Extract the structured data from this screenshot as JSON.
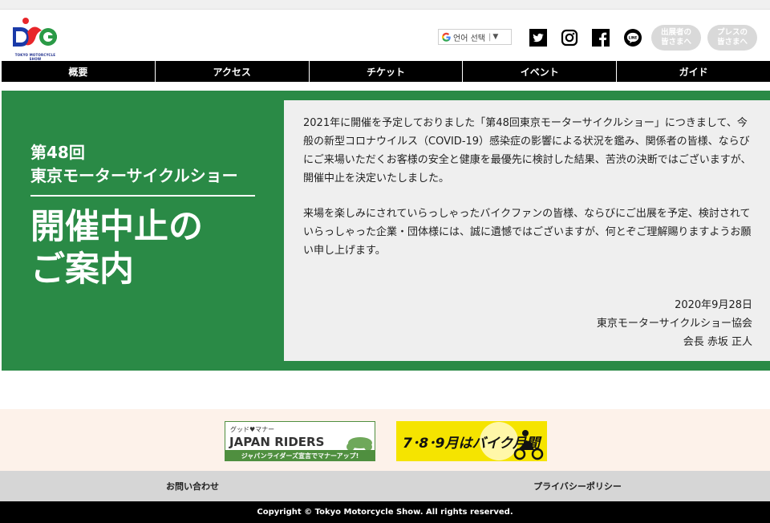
{
  "header": {
    "logo_text": "TOKYO MOTORCYCLE SHOW",
    "translate_label": "언어 선택",
    "social_icons": [
      "twitter-icon",
      "instagram-icon",
      "facebook-icon",
      "line-icon"
    ],
    "exhibitor_line1": "出展者の",
    "exhibitor_line2": "皆さまへ",
    "press_line1": "プレスの",
    "press_line2": "皆さまへ"
  },
  "nav": {
    "items": [
      {
        "label": "概要"
      },
      {
        "label": "アクセス"
      },
      {
        "label": "チケット"
      },
      {
        "label": "イベント"
      },
      {
        "label": "ガイド"
      }
    ]
  },
  "hero": {
    "sub_line1": "第48回",
    "sub_line2": "東京モーターサイクルショー",
    "big_title": "開催中止の\nご案内",
    "accent_color": "#2a8a46"
  },
  "message": {
    "paragraph1": "2021年に開催を予定しておりました「第48回東京モーターサイクルショー」につきまして、今般の新型コロナウイルス（COVID-19）感染症の影響による状況を鑑み、関係者の皆様、ならびにご来場いただくお客様の安全と健康を最優先に検討した結果、苦渋の決断ではございますが、開催中止を決定いたしました。",
    "paragraph2": "来場を楽しみにされていらっしゃったバイクファンの皆様、ならびにご出展を予定、検討されていらっしゃった企業・団体様には、誠に遺憾ではございますが、何とぞご理解賜りますようお願い申し上げます。",
    "date": "2020年9月28日",
    "organization": "東京モーターサイクルショー協会",
    "signatory": "会長 赤坂 正人"
  },
  "banners": {
    "banner1_top": "グッド♥マナー",
    "banner1_main": "JAPAN RIDERS",
    "banner1_bottom": "ジャパンライダーズ宣言でマナーアップ!",
    "banner2_text": "7･8･9月はバイク月間"
  },
  "footer": {
    "contact": "お問い合わせ",
    "privacy": "プライバシーポリシー",
    "copyright": "Copyright © Tokyo Motorcycle Show. All rights reserved."
  }
}
